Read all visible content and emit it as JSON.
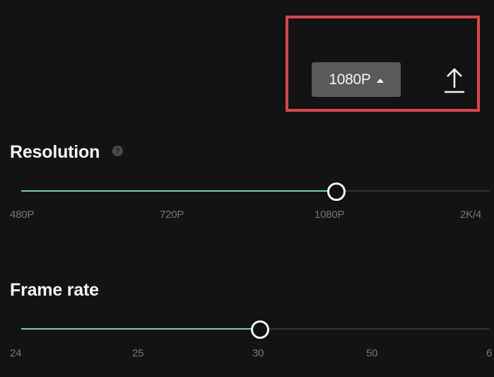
{
  "export_header": {
    "resolution_button_label": "1080P",
    "icons": {
      "caret": "caret-up-icon",
      "export": "upload-icon"
    }
  },
  "resolution": {
    "title": "Resolution",
    "help_icon": "question-circle-icon",
    "ticks": [
      "480P",
      "720P",
      "1080P",
      "2K/4"
    ],
    "selected_index": 2,
    "accent_color": "#77c8bf"
  },
  "frame_rate": {
    "title": "Frame rate",
    "ticks": [
      "24",
      "25",
      "30",
      "50",
      "6"
    ],
    "selected_index": 2,
    "accent_color": "#77c8bf"
  },
  "colors": {
    "background": "#131313",
    "highlight_border": "#d8474d",
    "dropdown_bg": "#5a5a5a"
  }
}
